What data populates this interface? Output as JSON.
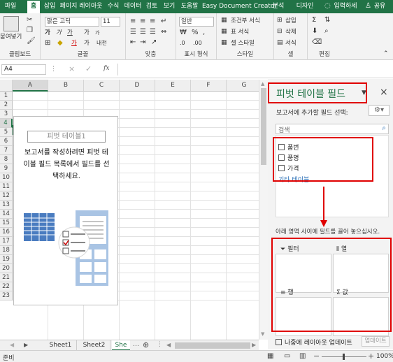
{
  "tabs": [
    "파일",
    "홈",
    "삽입",
    "페이지 레이아웃",
    "수식",
    "데이터",
    "검토",
    "보기",
    "도움말",
    "Easy Document Creator",
    "분석",
    "디자인",
    "입력하세",
    "공유"
  ],
  "ribbon": {
    "clipboard": {
      "paste": "붙여넣기",
      "label": "클립보드"
    },
    "font": {
      "name": "맑은 고딕",
      "size": "11",
      "label": "글꼴",
      "bold": "가",
      "italic": "가",
      "underline": "가",
      "grow": "가",
      "shrink": "가",
      "fontcolor": "가",
      "highlight": "가",
      "phonetic": "내천"
    },
    "align": {
      "label": "맞춤"
    },
    "number": {
      "format": "일반",
      "label": "표시 형식"
    },
    "styles": {
      "cond": "조건부 서식",
      "table": "표 서식",
      "cell": "셀 스타일",
      "label": "스타일"
    },
    "cells": {
      "insert": "삽입",
      "delete": "삭제",
      "format": "서식",
      "label": "셀"
    },
    "edit": {
      "label": "편집"
    }
  },
  "formula": {
    "namebox": "A4",
    "fx": "fx",
    "cancel": "×",
    "confirm": "✓"
  },
  "columns": [
    "A",
    "B",
    "C",
    "D",
    "E",
    "F",
    "G"
  ],
  "rows": [
    "1",
    "2",
    "3",
    "4",
    "5",
    "6",
    "7",
    "8",
    "9",
    "10",
    "11",
    "12",
    "13",
    "14",
    "15",
    "16",
    "17",
    "18",
    "19",
    "20",
    "21",
    "22",
    "23"
  ],
  "pivot": {
    "name": "피벗 테이블1",
    "instructions": [
      "보고서를 작성하려면 피벗 테",
      "이블 필드 목록에서 필드를 선",
      "택하세요."
    ]
  },
  "panel": {
    "title": "피벗 테이블 필드",
    "choose": "보고서에 추가할 필드 선택:",
    "search": "검색",
    "fields": [
      "품번",
      "품명",
      "가격"
    ],
    "more": "기타 테이블...",
    "drag": "아래 영역 사이에 필드를 끌어 놓으십시오.",
    "areas": {
      "filter": "필터",
      "columns": "열",
      "rows": "행",
      "values": "값"
    },
    "defer": "나중에 레이아웃 업데이트",
    "update": "업데이트"
  },
  "sheets": [
    "Sheet1",
    "Sheet2",
    "She"
  ],
  "status": {
    "ready": "준비",
    "zoom": "100%"
  },
  "colors": {
    "excel_green": "#217346",
    "highlight_red": "#e00000",
    "title_green": "#217346"
  }
}
